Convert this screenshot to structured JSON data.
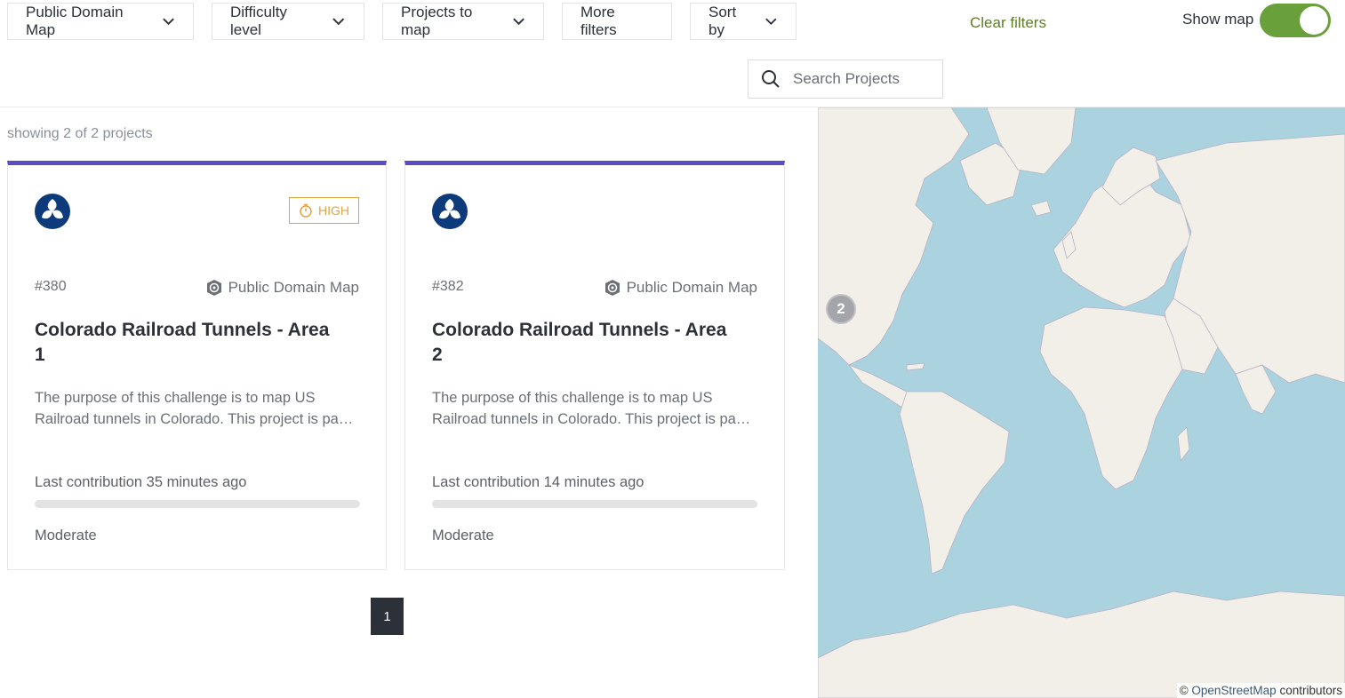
{
  "filters": {
    "organization": "Public Domain Map",
    "difficulty": "Difficulty level",
    "projects_to_map": "Projects to map",
    "more_filters": "More filters",
    "sort_by": "Sort by",
    "clear": "Clear filters",
    "show_map": "Show map",
    "show_map_on": true
  },
  "search": {
    "placeholder": "Search Projects"
  },
  "results": {
    "count_text": "showing 2 of 2 projects"
  },
  "projects": [
    {
      "id": "#380",
      "priority": "HIGH",
      "organization": "Public Domain Map",
      "title": "Colorado Railroad Tunnels - Area 1",
      "description": "The purpose of this challenge is to map US Railroad tunnels in Colorado. This project is pa…",
      "last_contribution": "Last contribution 35 minutes ago",
      "progress": 0,
      "difficulty": "Moderate"
    },
    {
      "id": "#382",
      "priority": "",
      "organization": "Public Domain Map",
      "title": "Colorado Railroad Tunnels - Area 2",
      "description": "The purpose of this challenge is to map US Railroad tunnels in Colorado. This project is pa…",
      "last_contribution": "Last contribution 14 minutes ago",
      "progress": 0,
      "difficulty": "Moderate"
    }
  ],
  "pagination": {
    "current": "1"
  },
  "map": {
    "cluster_count": "2",
    "attribution_prefix": "© ",
    "attribution_link": "OpenStreetMap",
    "attribution_suffix": " contributors"
  },
  "colors": {
    "card_accent": "#5b4cc4",
    "priority_high": "#e2a43a",
    "toggle_on": "#69a03c",
    "clear_filters": "#5e7d2a",
    "ocean": "#aad3df",
    "land": "#f2efe9"
  }
}
